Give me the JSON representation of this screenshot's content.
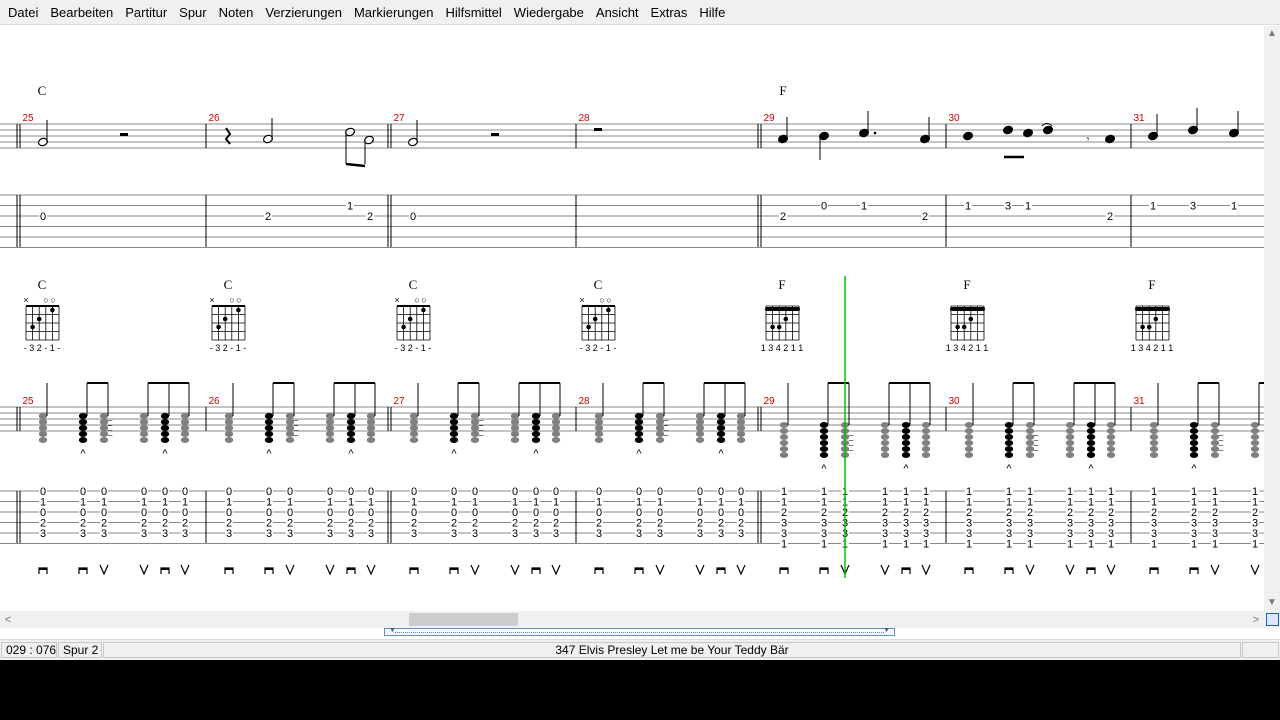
{
  "menu": [
    "Datei",
    "Bearbeiten",
    "Partitur",
    "Spur",
    "Noten",
    "Verzierungen",
    "Markierungen",
    "Hilfsmittel",
    "Wiedergabe",
    "Ansicht",
    "Extras",
    "Hilfe"
  ],
  "colors": {
    "bar_number": "#d00000",
    "cursor": "#00c000",
    "note": "#000000",
    "note_inactive": "#808080",
    "staff_line": "#888888"
  },
  "staff1": {
    "measures": [
      25,
      26,
      27,
      28,
      29,
      30,
      31
    ],
    "chords": [
      {
        "measure": 25,
        "name": "C"
      },
      {
        "measure": 29,
        "name": "F"
      }
    ],
    "tab": [
      {
        "measure": 25,
        "frets": [
          "0"
        ]
      },
      {
        "measure": 26,
        "frets": [
          "2",
          "1",
          "2"
        ]
      },
      {
        "measure": 27,
        "frets": [
          "0"
        ]
      },
      {
        "measure": 28,
        "frets": []
      },
      {
        "measure": 29,
        "frets": [
          "2",
          "0",
          "1",
          "2"
        ]
      },
      {
        "measure": 30,
        "frets": [
          "1",
          "3",
          "1",
          "2"
        ]
      },
      {
        "measure": 31,
        "frets": [
          "1",
          "3",
          "1"
        ]
      }
    ]
  },
  "staff2": {
    "measures": [
      25,
      26,
      27,
      28,
      29,
      30,
      31
    ],
    "chord_diagrams": [
      {
        "name": "C",
        "open_mute": "× ○ ○",
        "fingering": "-32-1-"
      },
      {
        "name": "C",
        "open_mute": "× ○ ○",
        "fingering": "-32-1-"
      },
      {
        "name": "C",
        "open_mute": "× ○ ○",
        "fingering": "-32-1-"
      },
      {
        "name": "C",
        "open_mute": "× ○ ○",
        "fingering": "-32-1-"
      },
      {
        "name": "F",
        "open_mute": "",
        "fingering": "134211"
      },
      {
        "name": "F",
        "open_mute": "",
        "fingering": "134211"
      },
      {
        "name": "F",
        "open_mute": "",
        "fingering": "134211"
      }
    ],
    "tab_columns": {
      "C": [
        "0",
        "1",
        "0",
        "2",
        "3"
      ],
      "F": [
        "1",
        "1",
        "2",
        "3",
        "3",
        "1"
      ]
    }
  },
  "status": {
    "position": "029 : 076",
    "track": "Spur 2",
    "song": "347  Elvis Presley   Let me be Your  Teddy Bär"
  }
}
